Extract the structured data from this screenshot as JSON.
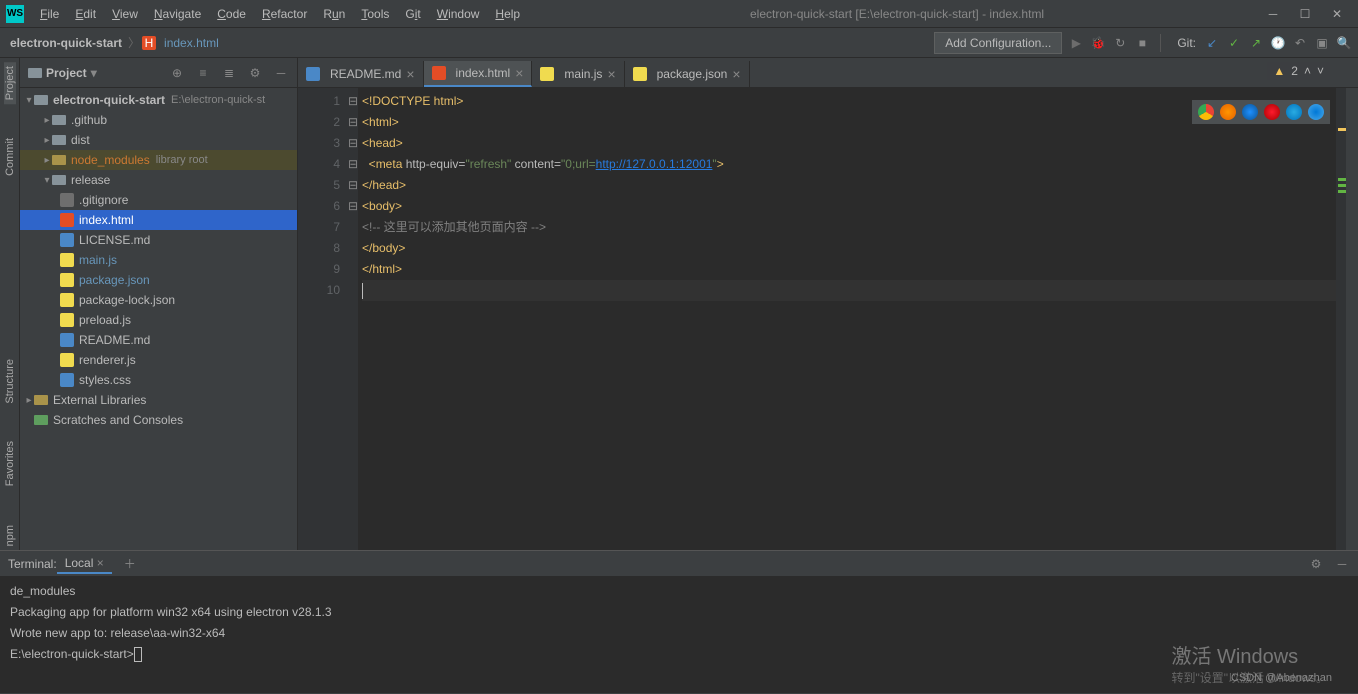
{
  "app_logo": "WS",
  "menu": [
    "File",
    "Edit",
    "View",
    "Navigate",
    "Code",
    "Refactor",
    "Run",
    "Tools",
    "Git",
    "Window",
    "Help"
  ],
  "title": "electron-quick-start [E:\\electron-quick-start] - index.html",
  "breadcrumb": {
    "project": "electron-quick-start",
    "file": "index.html"
  },
  "add_config": "Add Configuration...",
  "git_label": "Git:",
  "sidebar": {
    "title": "Project",
    "root": {
      "name": "electron-quick-start",
      "path": "E:\\electron-quick-st"
    },
    "folders": [
      ".github",
      "dist",
      "node_modules",
      "release"
    ],
    "lib_hint": "library root",
    "files": [
      ".gitignore",
      "index.html",
      "LICENSE.md",
      "main.js",
      "package.json",
      "package-lock.json",
      "preload.js",
      "README.md",
      "renderer.js",
      "styles.css"
    ],
    "extras": [
      "External Libraries",
      "Scratches and Consoles"
    ]
  },
  "rails_left": [
    "Project",
    "Commit",
    "Structure",
    "Favorites",
    "npm"
  ],
  "tabs": [
    {
      "label": "README.md",
      "icon": "md",
      "active": false,
      "modified": false
    },
    {
      "label": "index.html",
      "icon": "html",
      "active": true,
      "modified": true
    },
    {
      "label": "main.js",
      "icon": "js",
      "active": false,
      "modified": false
    },
    {
      "label": "package.json",
      "icon": "json",
      "active": false,
      "modified": false
    }
  ],
  "code_lines": [
    "1",
    "2",
    "3",
    "4",
    "5",
    "6",
    "7",
    "8",
    "9",
    "10"
  ],
  "code": {
    "doctype": "<!DOCTYPE html>",
    "html_open": "html",
    "head_open": "head",
    "meta": "meta",
    "equiv_attr": "http-equiv=",
    "equiv_val": "\"refresh\"",
    "content_attr": "content=",
    "content_prefix": "\"0;url=",
    "url": "http://127.0.0.1:12001",
    "content_suffix": "\"",
    "head_close": "/head",
    "body_open": "body",
    "comment": "<!-- 这里可以添加其他页面内容 -->",
    "body_close": "/body",
    "html_close": "/html"
  },
  "warnings": "2",
  "terminal": {
    "label": "Terminal:",
    "tab": "Local",
    "lines": [
      "de_modules",
      "",
      "Packaging app for platform win32 x64 using electron v28.1.3",
      "Wrote new app to: release\\aa-win32-x64",
      "",
      "E:\\electron-quick-start>"
    ]
  },
  "watermark": {
    "big": "激活 Windows",
    "small": "转到\"设置\"以激活 Windows。"
  },
  "csdn": "CSDN @Abenazhan"
}
